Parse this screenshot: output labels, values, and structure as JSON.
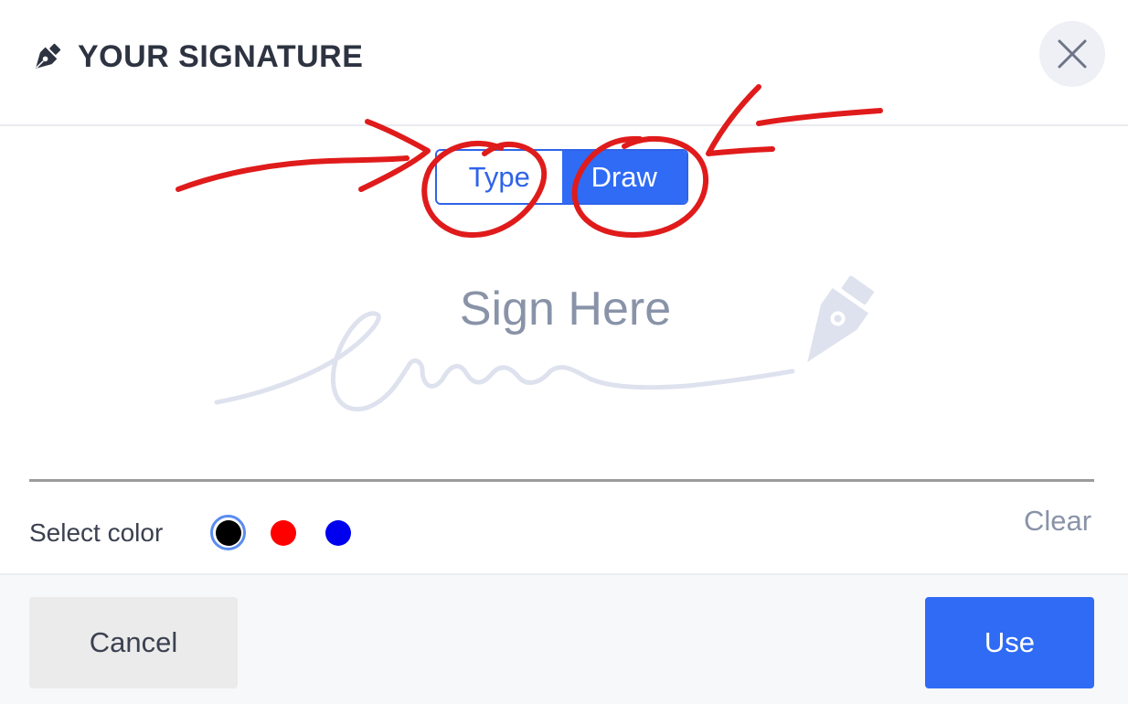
{
  "header": {
    "title": "YOUR SIGNATURE",
    "icon": "pen-nib-icon",
    "close_icon": "close-icon"
  },
  "mode_toggle": {
    "options": [
      {
        "label": "Type",
        "selected": false
      },
      {
        "label": "Draw",
        "selected": true
      }
    ]
  },
  "canvas": {
    "placeholder": "Sign Here",
    "illustration": "signature-pen-illustration"
  },
  "color_picker": {
    "label": "Select color",
    "options": [
      {
        "name": "black",
        "hex": "#000000",
        "selected": true
      },
      {
        "name": "red",
        "hex": "#ff0000",
        "selected": false
      },
      {
        "name": "blue",
        "hex": "#0000ee",
        "selected": false
      }
    ],
    "clear_label": "Clear"
  },
  "footer": {
    "cancel_label": "Cancel",
    "use_label": "Use"
  },
  "colors": {
    "accent": "#2f6bf5",
    "annotation": "#e01b1b",
    "placeholder": "#8993a8"
  }
}
